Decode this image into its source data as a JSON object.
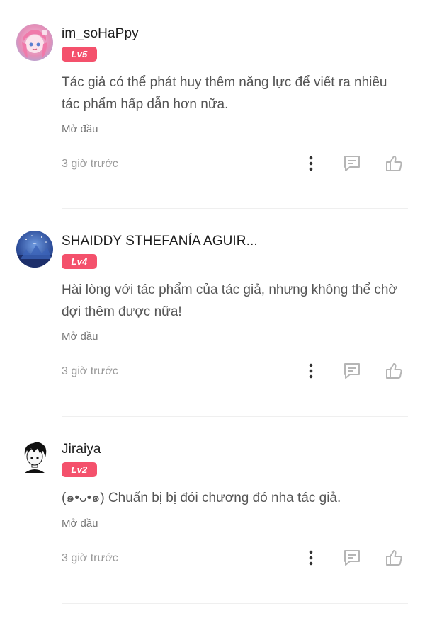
{
  "comments": [
    {
      "username": "im_soHaPpy",
      "level": "Lv5",
      "avatar": "anime-girl-pink-avatar",
      "content": "Tác giả có thể phát huy thêm năng lực để viết ra nhiều tác phẩm hấp dẫn hơn nữa.",
      "source": "Mở đầu",
      "time": "3 giờ trước"
    },
    {
      "username": "SHAIDDY STHEFANÍA AGUIR...",
      "level": "Lv4",
      "avatar": "blue-night-scene-avatar",
      "content": "Hài lòng với tác phẩm của tác giả, nhưng không thể chờ đợi thêm được nữa!",
      "source": "Mở đầu",
      "time": "3 giờ trước"
    },
    {
      "username": "Jiraiya",
      "level": "Lv2",
      "avatar": "black-hair-boy-avatar",
      "content": "(๑•ᴗ•๑) Chuẩn bị bị đói chương đó nha tác giả.",
      "source": "Mở đầu",
      "time": "3 giờ trước"
    }
  ],
  "colors": {
    "level_badge": "#f4516c",
    "icon_gray": "#b5b5b5",
    "more_dots": "#333333"
  },
  "icons": {
    "more": "more-vertical-icon",
    "reply": "comment-icon",
    "like": "thumbs-up-icon"
  }
}
